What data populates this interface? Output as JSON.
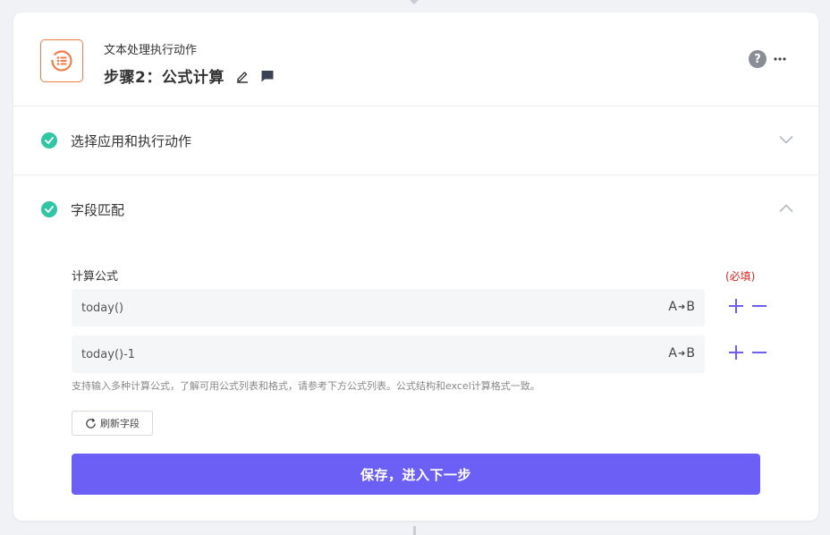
{
  "header": {
    "subtitle": "文本处理执行动作",
    "title": "步骤2：公式计算"
  },
  "sections": [
    {
      "label": "选择应用和执行动作",
      "expanded": false
    },
    {
      "label": "字段匹配",
      "expanded": true
    }
  ],
  "field": {
    "label": "计算公式",
    "required": "(必填)",
    "formulas": [
      {
        "value": "today()",
        "tag_a": "A",
        "tag_b": "B"
      },
      {
        "value": "today()-1",
        "tag_a": "A",
        "tag_b": "B"
      }
    ],
    "hint": "支持输入多种计算公式，了解可用公式列表和格式，请参考下方公式列表。公式结构和excel计算格式一致。"
  },
  "refresh_label": "刷新字段",
  "save_label": "保存，进入下一步",
  "colors": {
    "accent": "#6c5ff6",
    "success": "#2fc6a3",
    "icon_orange": "#ee7e4a",
    "required": "#e02424"
  }
}
